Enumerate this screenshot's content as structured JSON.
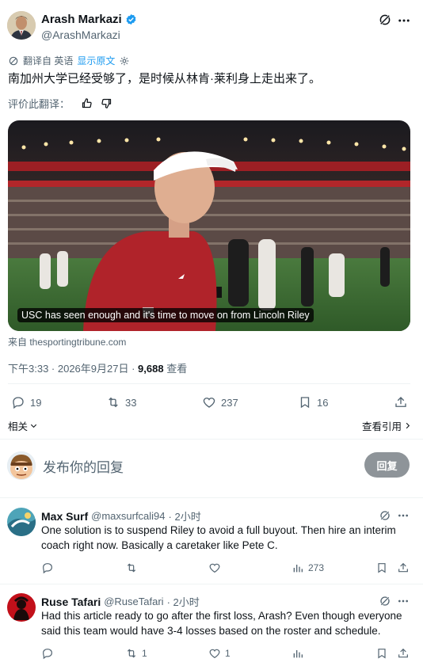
{
  "main_tweet": {
    "author_name": "Arash Markazi",
    "handle": "@ArashMarkazi",
    "translated_label": "翻译自 英语",
    "show_original": "显示原文",
    "text": "南加州大学已经受够了，是时候从林肯·莱利身上走出来了。",
    "rate_translation": "评价此翻译：",
    "card_caption": "USC has seen enough and it's time to move on from Lincoln Riley",
    "card_source": "来自 thesportingtribune.com",
    "time": "下午3:33 · 2026年9月27日 · ",
    "views_count": "9,688",
    "views_label": " 查看",
    "stats": {
      "replies": "19",
      "reposts": "33",
      "likes": "237",
      "bookmarks": "16"
    },
    "related": "相关",
    "view_quotes": "查看引用"
  },
  "composer": {
    "placeholder": "发布你的回复",
    "reply_button": "回复"
  },
  "replies": [
    {
      "name": "Max Surf",
      "handle": "@maxsurfcali94",
      "time": "· 2小时",
      "text_line1": "One solution is to suspend Riley to avoid a full buyout. Then hire an interim",
      "text_line2": "coach right now. Basically a caretaker like Pete C.",
      "views": "273"
    },
    {
      "name": "Ruse Tafari",
      "handle": "@RuseTafari",
      "time": "· 2小时",
      "text_line1": "Had this article ready to go after the first loss, Arash? Even though everyone",
      "text_line2": "said this team would have 3-4 losses based on the roster and schedule.",
      "reposts": "1",
      "likes": "1"
    }
  ],
  "colors": {
    "accent": "#1d9bf0",
    "text": "#0f1419",
    "muted": "#536471",
    "verified": "#1d9bf0"
  }
}
